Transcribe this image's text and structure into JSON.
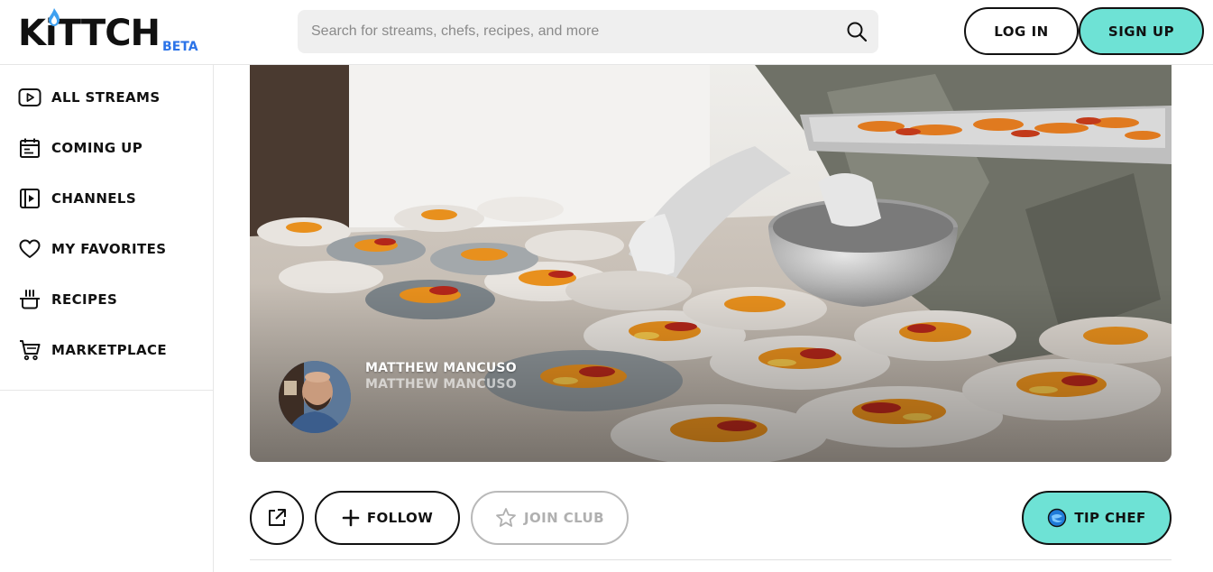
{
  "brand": {
    "name": "KiTTCH",
    "badge": "BETA",
    "accent": "#2b73e8"
  },
  "search": {
    "placeholder": "Search for streams, chefs, recipes, and more",
    "value": "",
    "icon": "search-icon"
  },
  "auth": {
    "login_label": "LOG IN",
    "signup_label": "SIGN UP",
    "signup_color": "#6ee2d5"
  },
  "sidebar": {
    "items": [
      {
        "label": "ALL STREAMS",
        "icon": "play-icon"
      },
      {
        "label": "COMING UP",
        "icon": "calendar-icon"
      },
      {
        "label": "CHANNELS",
        "icon": "channels-icon"
      },
      {
        "label": "MY FAVORITES",
        "icon": "heart-icon"
      },
      {
        "label": "RECIPES",
        "icon": "pot-icon"
      },
      {
        "label": "MARKETPLACE",
        "icon": "cart-icon"
      }
    ]
  },
  "channel": {
    "name": "MATTHEW MANCUSO",
    "handle": "MATTHEW MANCUSO"
  },
  "actions": {
    "share_icon": "share-icon",
    "follow_label": "FOLLOW",
    "join_label": "JOIN CLUB",
    "tip_label": "TIP CHEF",
    "tip_color": "#6ee2d5"
  }
}
